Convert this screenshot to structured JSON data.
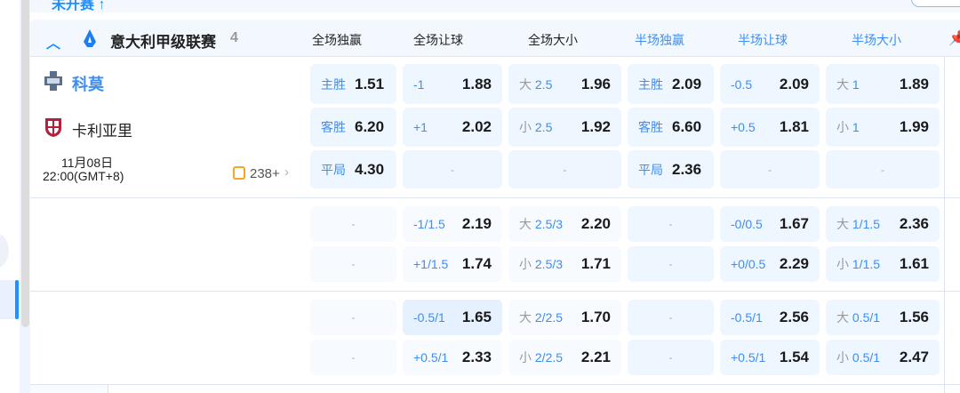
{
  "top": {
    "label": "未开赛 ↑"
  },
  "league": {
    "name": "意大利甲级联赛",
    "count": "4"
  },
  "columns": [
    "全场独赢",
    "全场让球",
    "全场大小",
    "半场独赢",
    "半场让球",
    "半场大小"
  ],
  "match": {
    "home": "科莫",
    "away": "卡利亚里",
    "date": "11月08日",
    "time": "22:00(GMT+8)",
    "more": "238+"
  },
  "colors": {
    "accent": "#1e90ff",
    "cell_primary": "#eef6ff",
    "cell_secondary": "#f7faff",
    "cell_hover": "#e6f1ff"
  },
  "blocks": [
    [
      [
        {
          "label": "主胜",
          "odds": "1.51"
        },
        {
          "line": "-1",
          "odds": "1.88"
        },
        {
          "prefix": "大",
          "line": "2.5",
          "odds": "1.96"
        },
        {
          "label": "主胜",
          "odds": "2.09"
        },
        {
          "line": "-0.5",
          "odds": "2.09"
        },
        {
          "prefix": "大",
          "line": "1",
          "odds": "1.89"
        }
      ],
      [
        {
          "label": "客胜",
          "odds": "6.20"
        },
        {
          "line": "+1",
          "odds": "2.02"
        },
        {
          "prefix": "小",
          "line": "2.5",
          "odds": "1.92"
        },
        {
          "label": "客胜",
          "odds": "6.60"
        },
        {
          "line": "+0.5",
          "odds": "1.81"
        },
        {
          "prefix": "小",
          "line": "1",
          "odds": "1.99"
        }
      ],
      [
        {
          "label": "平局",
          "odds": "4.30"
        },
        {
          "empty": "-"
        },
        {
          "empty": "-"
        },
        {
          "label": "平局",
          "odds": "2.36"
        },
        {
          "empty": "-"
        },
        {
          "empty": "-"
        }
      ]
    ],
    [
      [
        {
          "empty": "-"
        },
        {
          "line": "-1/1.5",
          "odds": "2.19"
        },
        {
          "prefix": "大",
          "line": "2.5/3",
          "odds": "2.20"
        },
        {
          "empty": "-"
        },
        {
          "line": "-0/0.5",
          "odds": "1.67"
        },
        {
          "prefix": "大",
          "line": "1/1.5",
          "odds": "2.36"
        }
      ],
      [
        {
          "empty": "-"
        },
        {
          "line": "+1/1.5",
          "odds": "1.74"
        },
        {
          "prefix": "小",
          "line": "2.5/3",
          "odds": "1.71"
        },
        {
          "empty": "-"
        },
        {
          "line": "+0/0.5",
          "odds": "2.29"
        },
        {
          "prefix": "小",
          "line": "1/1.5",
          "odds": "1.61"
        }
      ]
    ],
    [
      [
        {
          "empty": "-"
        },
        {
          "line": "-0.5/1",
          "odds": "1.65",
          "hover": true
        },
        {
          "prefix": "大",
          "line": "2/2.5",
          "odds": "1.70"
        },
        {
          "empty": "-"
        },
        {
          "line": "-0.5/1",
          "odds": "2.56"
        },
        {
          "prefix": "大",
          "line": "0.5/1",
          "odds": "1.56"
        }
      ],
      [
        {
          "empty": "-"
        },
        {
          "line": "+0.5/1",
          "odds": "2.33"
        },
        {
          "prefix": "小",
          "line": "2/2.5",
          "odds": "2.21"
        },
        {
          "empty": "-"
        },
        {
          "line": "+0.5/1",
          "odds": "1.54"
        },
        {
          "prefix": "小",
          "line": "0.5/1",
          "odds": "2.47"
        }
      ]
    ]
  ]
}
